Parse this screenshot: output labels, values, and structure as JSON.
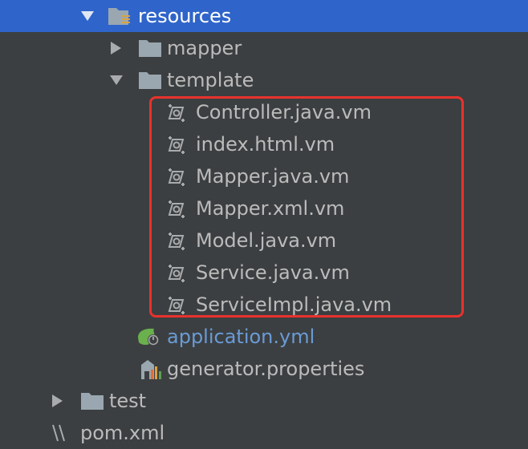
{
  "tree": {
    "resources": "resources",
    "mapper": "mapper",
    "template": "template",
    "template_files": [
      "Controller.java.vm",
      "index.html.vm",
      "Mapper.java.vm",
      "Mapper.xml.vm",
      "Model.java.vm",
      "Service.java.vm",
      "ServiceImpl.java.vm"
    ],
    "application_yml": "application.yml",
    "generator_properties": "generator.properties",
    "test": "test",
    "pom": "pom.xml"
  },
  "colors": {
    "background": "#3c3f41",
    "selection": "#2f65ca",
    "text": "#bbbbbb",
    "link_text": "#6a9bd6",
    "highlight_border": "#e8322d"
  },
  "icons": {
    "folder": "folder-icon",
    "resources_folder": "resources-folder-icon",
    "velocity_template": "velocity-template-icon",
    "spring_yml": "spring-config-icon",
    "properties": "properties-file-icon",
    "maven": "maven-icon"
  }
}
